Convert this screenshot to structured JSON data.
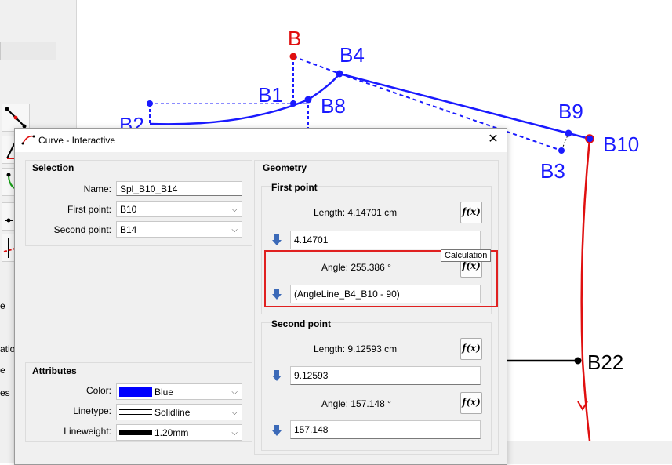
{
  "left_panel": {
    "labels": [
      "e",
      "atio",
      "e",
      "es"
    ]
  },
  "canvas": {
    "points": {
      "B": "B",
      "B1": "B1",
      "B2": "B2",
      "B3": "B3",
      "B4": "B4",
      "B8": "B8",
      "B9": "B9",
      "B10": "B10",
      "B22": "B22"
    },
    "colors": {
      "blue": "#1a1aff",
      "red": "#e01010",
      "black": "#000000"
    }
  },
  "dialog": {
    "title": "Curve - Interactive",
    "close_icon": "close-icon",
    "selection": {
      "title": "Selection",
      "name_label": "Name:",
      "name_value": "Spl_B10_B14",
      "first_label": "First point:",
      "first_value": "B10",
      "second_label": "Second point:",
      "second_value": "B14"
    },
    "attributes": {
      "title": "Attributes",
      "color_label": "Color:",
      "color_value": "Blue",
      "color_swatch": "#0000ff",
      "linetype_label": "Linetype:",
      "linetype_value": "Solidline",
      "lineweight_label": "Lineweight:",
      "lineweight_value": "1.20mm"
    },
    "geometry": {
      "title": "Geometry",
      "first": {
        "title": "First point",
        "length_text": "Length: 4.14701 cm",
        "length_value": "4.14701",
        "angle_text": "Angle: 255.386 °",
        "angle_value": "(AngleLine_B4_B10 - 90)"
      },
      "second": {
        "title": "Second point",
        "length_text": "Length: 9.12593 cm",
        "length_value": "9.12593",
        "angle_text": "Angle: 157.148 °",
        "angle_value": "157.148"
      },
      "fx_label": "f(x)"
    },
    "tooltip": "Calculation"
  }
}
